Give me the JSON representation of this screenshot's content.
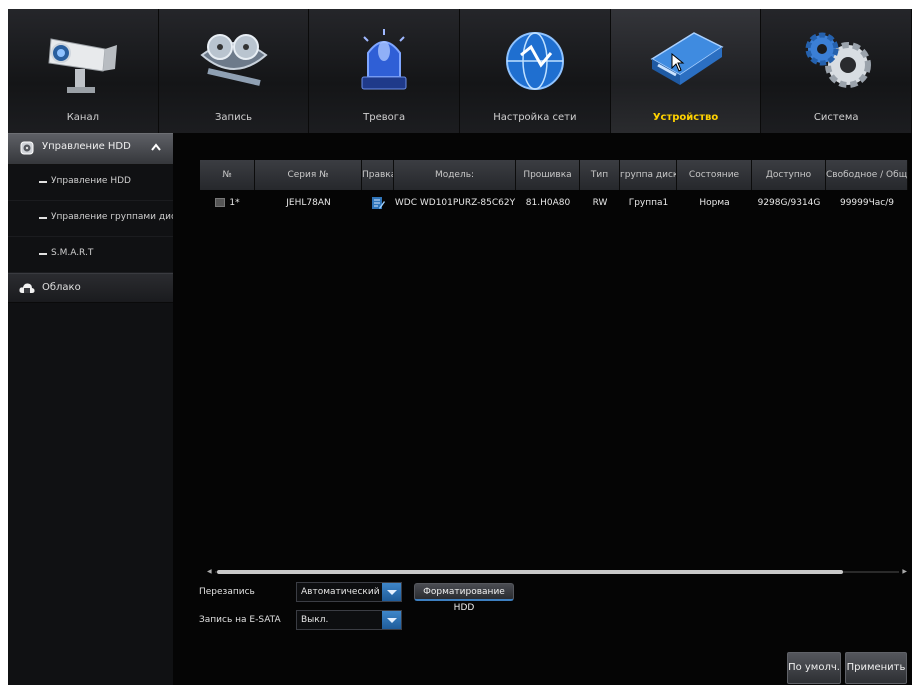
{
  "top_menu": [
    {
      "label": "Канал",
      "icon": "cctv-camera-icon",
      "active": false
    },
    {
      "label": "Запись",
      "icon": "film-reel-icon",
      "active": false
    },
    {
      "label": "Тревога",
      "icon": "alarm-siren-icon",
      "active": false
    },
    {
      "label": "Настройка сети",
      "icon": "network-globe-icon",
      "active": false
    },
    {
      "label": "Устройство",
      "icon": "hard-drive-icon",
      "active": true
    },
    {
      "label": "Система",
      "icon": "gears-icon",
      "active": false
    }
  ],
  "sidebar": {
    "hdd_section": "Управление HDD",
    "items": [
      "Управление HDD",
      "Управление группами дисков",
      "S.M.A.R.T"
    ],
    "cloud": "Облако"
  },
  "table": {
    "headers": [
      "№",
      "Серия №",
      "Правка",
      "Модель:",
      "Прошивка",
      "Тип",
      "группа диска",
      "Состояние",
      "Доступно",
      "Свободное / Общ"
    ],
    "rows": [
      {
        "num": "1*",
        "serial": "JEHL78AN",
        "model": "WDC WD101PURZ-85C62Y",
        "firmware": "81.H0A80",
        "type": "RW",
        "group": "Группа1",
        "status": "Норма",
        "available": "9298G/9314G",
        "free": "99999Час/9"
      }
    ]
  },
  "overwrite": {
    "label": "Перезапись",
    "value": "Автоматический"
  },
  "format_button": "Форматирование HDD",
  "esata": {
    "label": "Запись на  E-SATA",
    "value": "Выкл."
  },
  "buttons": {
    "default": "По умолч.",
    "apply": "Применить"
  },
  "colors": {
    "active_tab": "#ffd200",
    "accent_blue": "#2f74b8"
  }
}
